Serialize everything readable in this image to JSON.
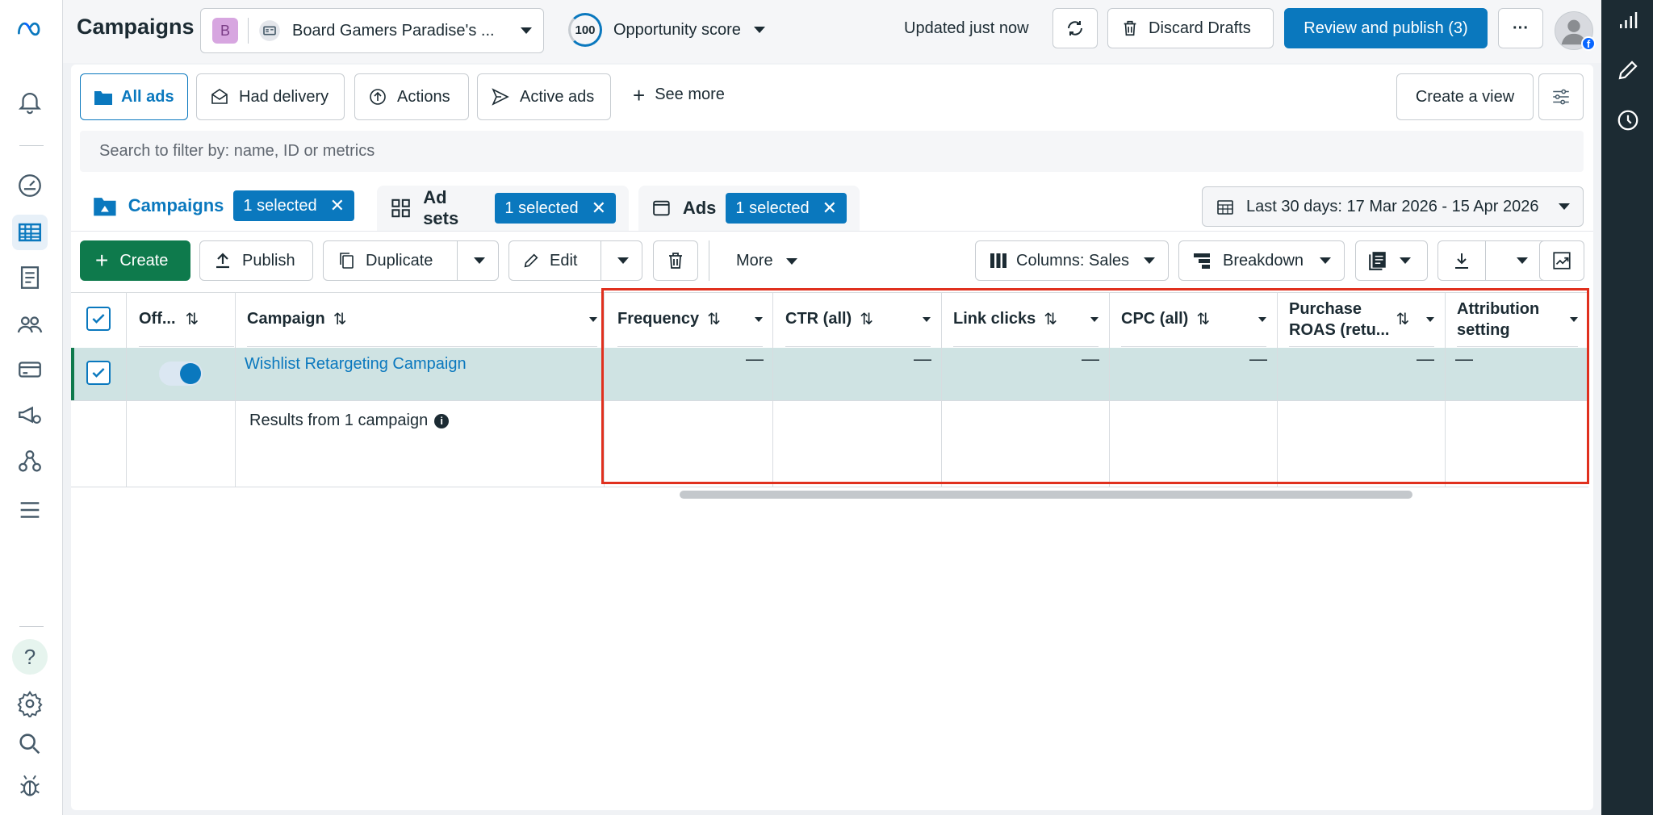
{
  "header": {
    "title": "Campaigns",
    "account_initial": "B",
    "account_name": "Board Gamers Paradise's ...",
    "opportunity_score_value": "100",
    "opportunity_score_label": "Opportunity score",
    "updated_text": "Updated just now",
    "discard_label": "Discard Drafts",
    "review_label": "Review and publish (3)",
    "more_label": "···"
  },
  "filters": {
    "tabs": [
      "All ads",
      "Had delivery",
      "Actions",
      "Active ads"
    ],
    "see_more": "See more",
    "create_view": "Create a view",
    "search_placeholder": "Search to filter by: name, ID or metrics"
  },
  "level_tabs": {
    "campaigns": {
      "label": "Campaigns",
      "badge": "1 selected"
    },
    "adsets": {
      "label": "Ad sets",
      "badge": "1 selected"
    },
    "ads": {
      "label": "Ads",
      "badge": "1 selected"
    },
    "badge_close": "✕"
  },
  "date_range": "Last 30 days: 17 Mar 2026 - 15 Apr 2026",
  "toolbar": {
    "create": "Create",
    "publish": "Publish",
    "duplicate": "Duplicate",
    "edit": "Edit",
    "more": "More",
    "columns": "Columns: Sales",
    "breakdown": "Breakdown"
  },
  "table": {
    "headers": {
      "off": "Off...",
      "campaign": "Campaign",
      "frequency": "Frequency",
      "ctr": "CTR (all)",
      "link_clicks": "Link clicks",
      "cpc": "CPC (all)",
      "roas_line1": "Purchase",
      "roas_line2": "ROAS (retu...",
      "attr_line1": "Attribution",
      "attr_line2": "setting"
    },
    "row": {
      "campaign_name": "Wishlist Retargeting Campaign",
      "toggle_on": true,
      "frequency": "—",
      "ctr": "—",
      "link_clicks": "—",
      "cpc": "—",
      "roas": "—",
      "attribution": "—"
    },
    "results_text": "Results from 1 campaign"
  },
  "colors": {
    "brand_blue": "#0a78be",
    "create_green": "#0e7a4c",
    "highlight_red": "#e0301e",
    "selected_row": "#cfe3e3"
  }
}
